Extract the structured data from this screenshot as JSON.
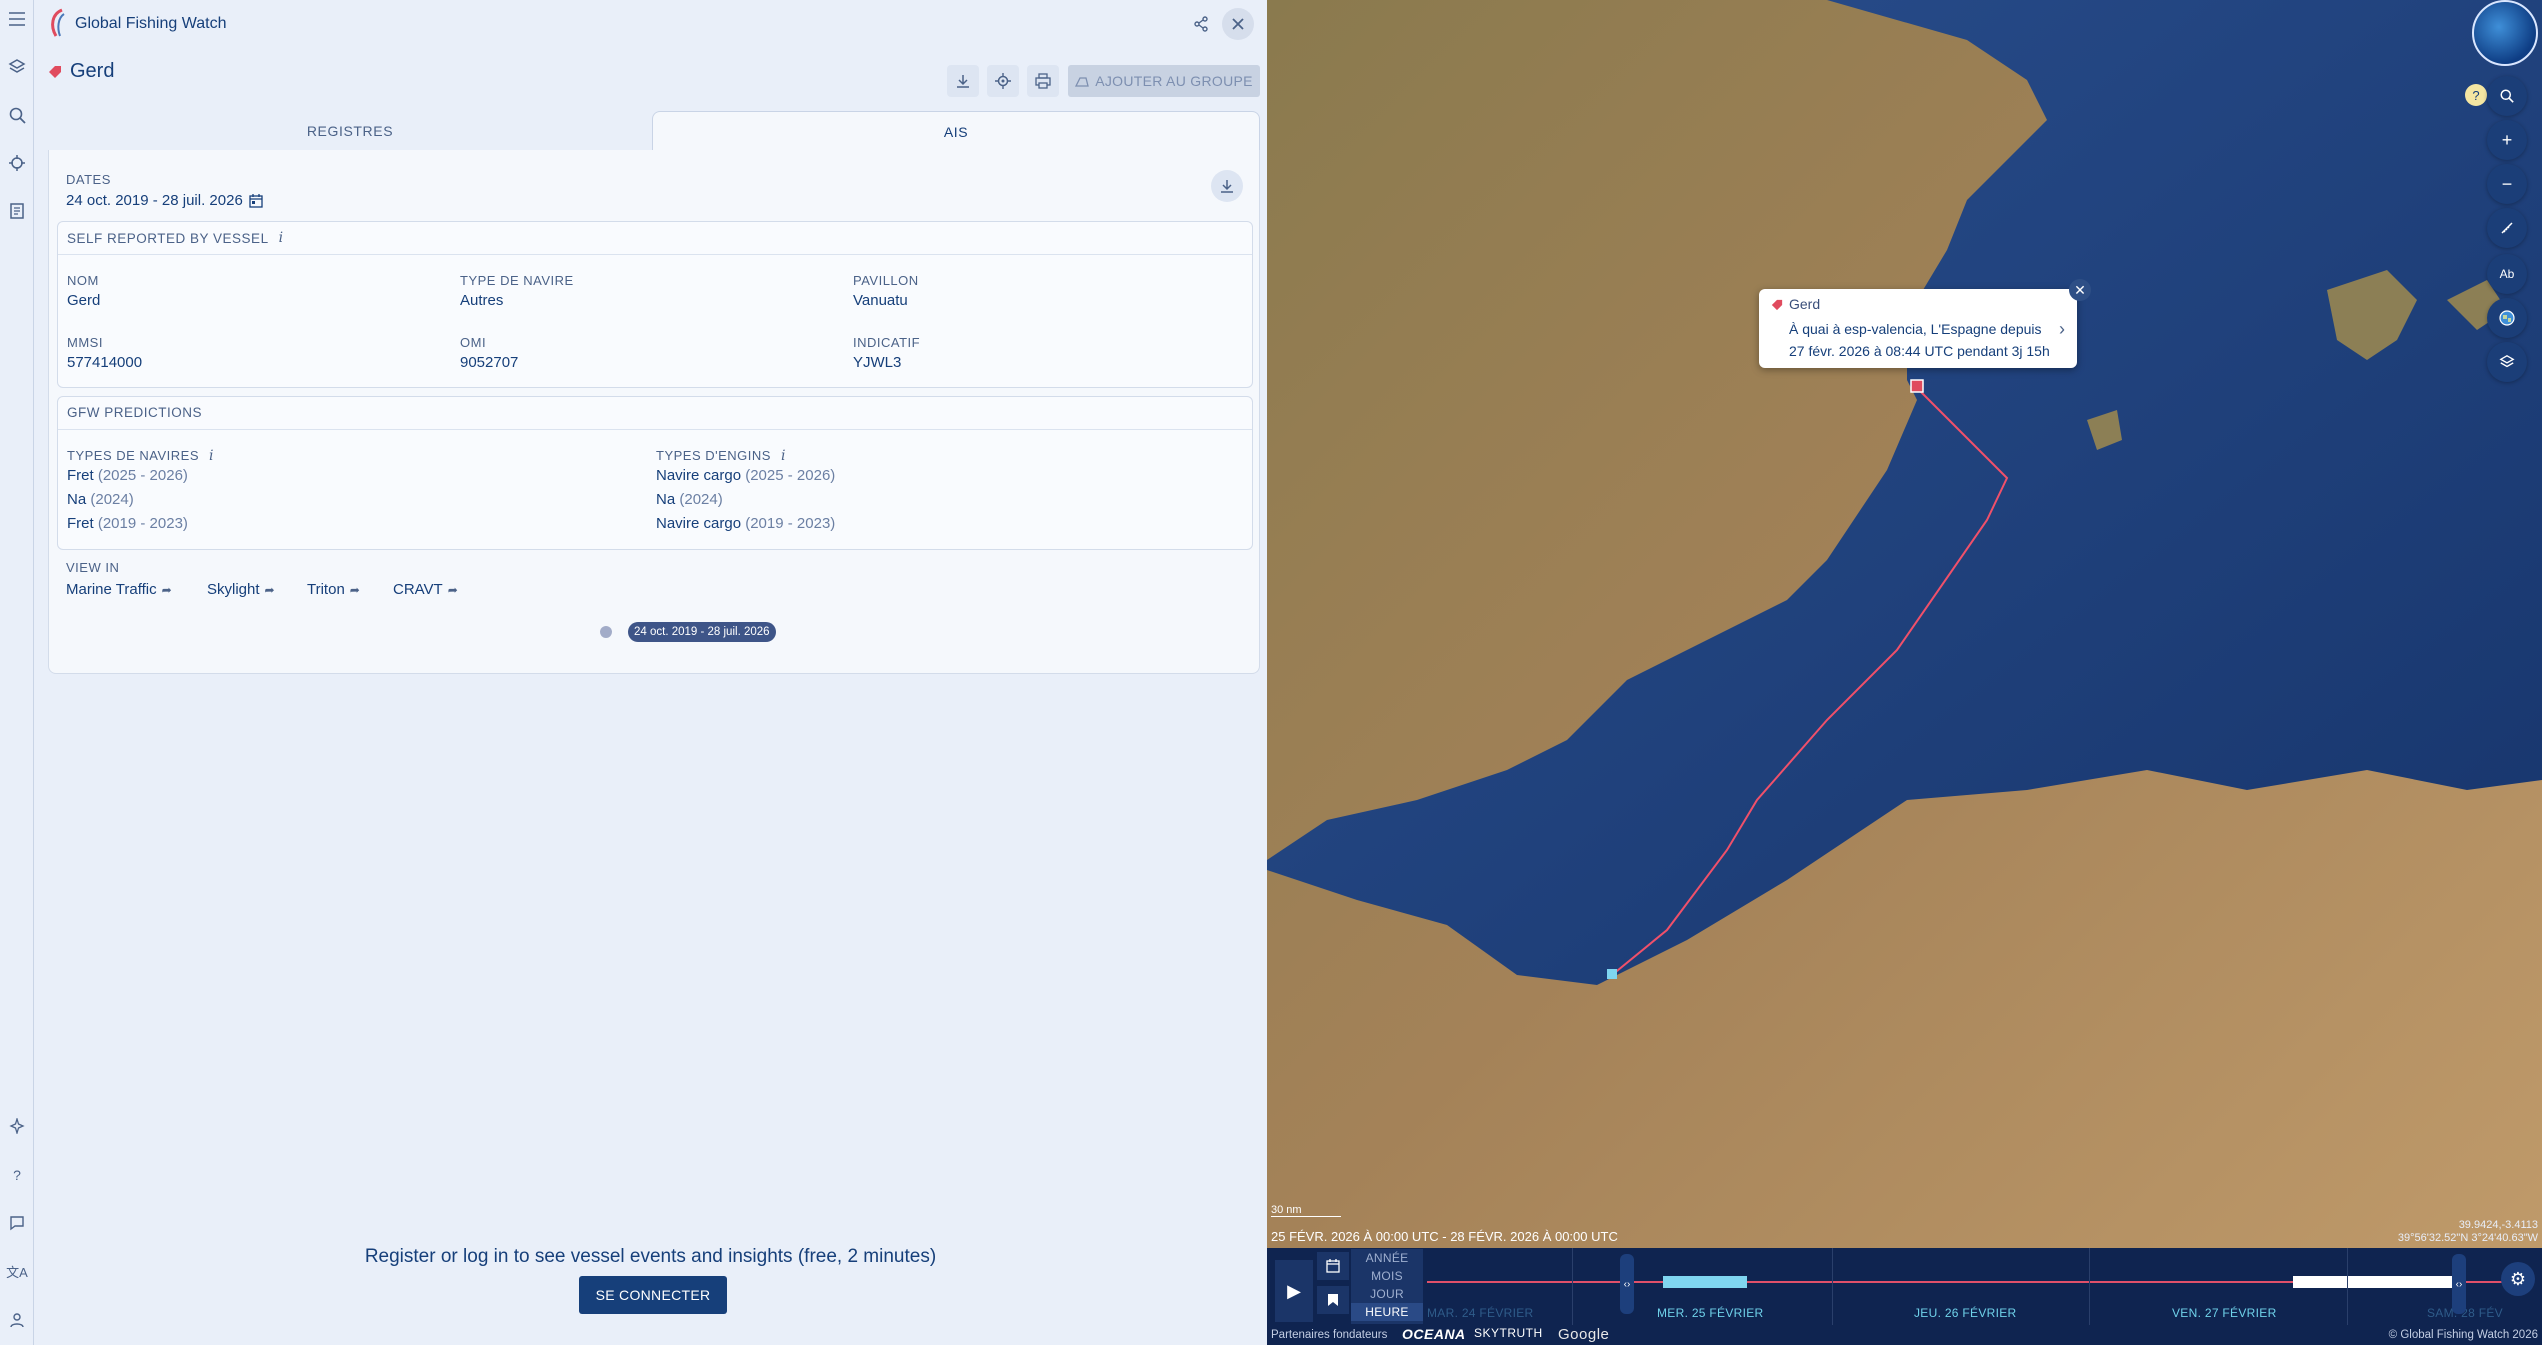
{
  "app": {
    "title": "Global Fishing Watch"
  },
  "vessel": {
    "name": "Gerd",
    "add_group_label": "AJOUTER AU GROUPE"
  },
  "tabs": [
    {
      "label": "REGISTRES"
    },
    {
      "label": "AIS"
    }
  ],
  "dates": {
    "label": "DATES",
    "value": "24 oct. 2019 - 28 juil. 2026"
  },
  "self_reported": {
    "title": "SELF REPORTED BY VESSEL",
    "fields": [
      {
        "label": "NOM",
        "value": "Gerd"
      },
      {
        "label": "TYPE DE NAVIRE",
        "value": "Autres"
      },
      {
        "label": "PAVILLON",
        "value": "Vanuatu"
      },
      {
        "label": "MMSI",
        "value": "577414000"
      },
      {
        "label": "OMI",
        "value": "9052707"
      },
      {
        "label": "INDICATIF",
        "value": "YJWL3"
      }
    ]
  },
  "predictions": {
    "title": "GFW PREDICTIONS",
    "vessel_types": {
      "label": "TYPES DE NAVIRES",
      "items": [
        {
          "value": "Fret",
          "years": "(2025 - 2026)"
        },
        {
          "value": "Na",
          "years": "(2024)"
        },
        {
          "value": "Fret",
          "years": "(2019 - 2023)"
        }
      ]
    },
    "gear_types": {
      "label": "TYPES D'ENGINS",
      "items": [
        {
          "value": "Navire cargo",
          "years": "(2025 - 2026)"
        },
        {
          "value": "Na",
          "years": "(2024)"
        },
        {
          "value": "Navire cargo",
          "years": "(2019 - 2023)"
        }
      ]
    }
  },
  "view_in": {
    "label": "VIEW IN",
    "links": [
      "Marine Traffic",
      "Skylight",
      "Triton",
      "CRAVT"
    ]
  },
  "timeline_pill": "24 oct. 2019 - 28 juil. 2026",
  "register": {
    "message": "Register or log in to see vessel events and insights (free, 2 minutes)",
    "button": "SE CONNECTER"
  },
  "map": {
    "popup": {
      "name": "Gerd",
      "line1": "À quai à esp-valencia, L'Espagne depuis",
      "line2": "27 févr. 2026 à 08:44 UTC pendant 3j 15h"
    },
    "scale": "30 nm",
    "coords_line1": "39.9424,-3.4113",
    "coords_line2": "39°56'32.52\"N 3°24'40.63\"W",
    "range": "25 FÉVR. 2026 À 00:00 UTC - 28 FÉVR. 2026 À 00:00 UTC",
    "help": "?",
    "label_icon": "Ab",
    "track_color": "#f0506a"
  },
  "timebar": {
    "granularity": [
      "ANNÉE",
      "MOIS",
      "JOUR",
      "HEURE"
    ],
    "days": [
      "MAR. 24 FÉVRIER",
      "MER. 25 FÉVRIER",
      "JEU. 26 FÉVRIER",
      "VEN. 27 FÉVRIER",
      "SAM. 28 FÉV"
    ],
    "partners_label": "Partenaires fondateurs",
    "partners": [
      "OCEANA",
      "SKYTRUTH",
      "Google"
    ],
    "copyright": "© Global Fishing Watch 2026"
  }
}
